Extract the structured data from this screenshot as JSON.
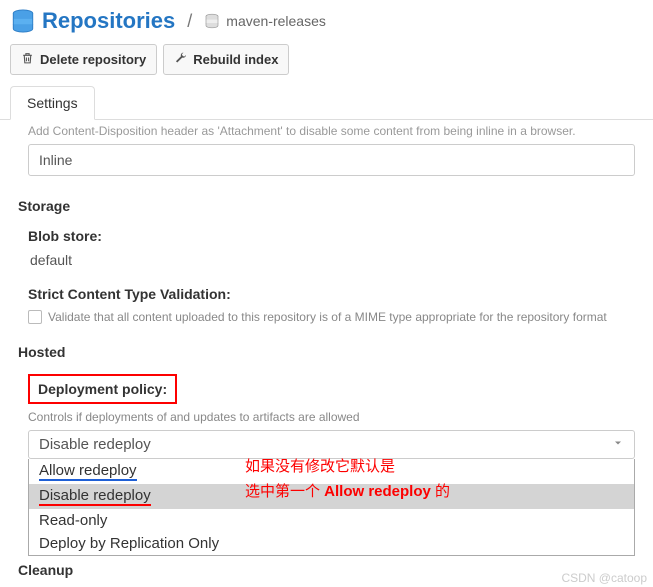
{
  "header": {
    "title": "Repositories",
    "breadcrumb": "maven-releases"
  },
  "toolbar": {
    "delete": "Delete repository",
    "rebuild": "Rebuild index"
  },
  "tabs": {
    "settings": "Settings"
  },
  "contentDisp": {
    "helpCut": "Add Content-Disposition header as 'Attachment' to disable some content from being inline in a browser.",
    "value": "Inline"
  },
  "storage": {
    "heading": "Storage",
    "blobLabel": "Blob store:",
    "blobValue": "default",
    "strictLabel": "Strict Content Type Validation:",
    "strictHelp": "Validate that all content uploaded to this repository is of a MIME type appropriate for the repository format"
  },
  "hosted": {
    "heading": "Hosted",
    "deployLabel": "Deployment policy:",
    "deployHelp": "Controls if deployments of and updates to artifacts are allowed",
    "selected": "Disable redeploy",
    "options": [
      "Allow redeploy",
      "Disable redeploy",
      "Read-only",
      "Deploy by Replication Only"
    ]
  },
  "cleanup": "Cleanup",
  "annotations": {
    "line1": "如果没有修改它默认是",
    "line2a": "选中第一个 ",
    "line2b": "Allow redeploy",
    "line2c": " 的"
  },
  "watermark": "CSDN @catoop"
}
